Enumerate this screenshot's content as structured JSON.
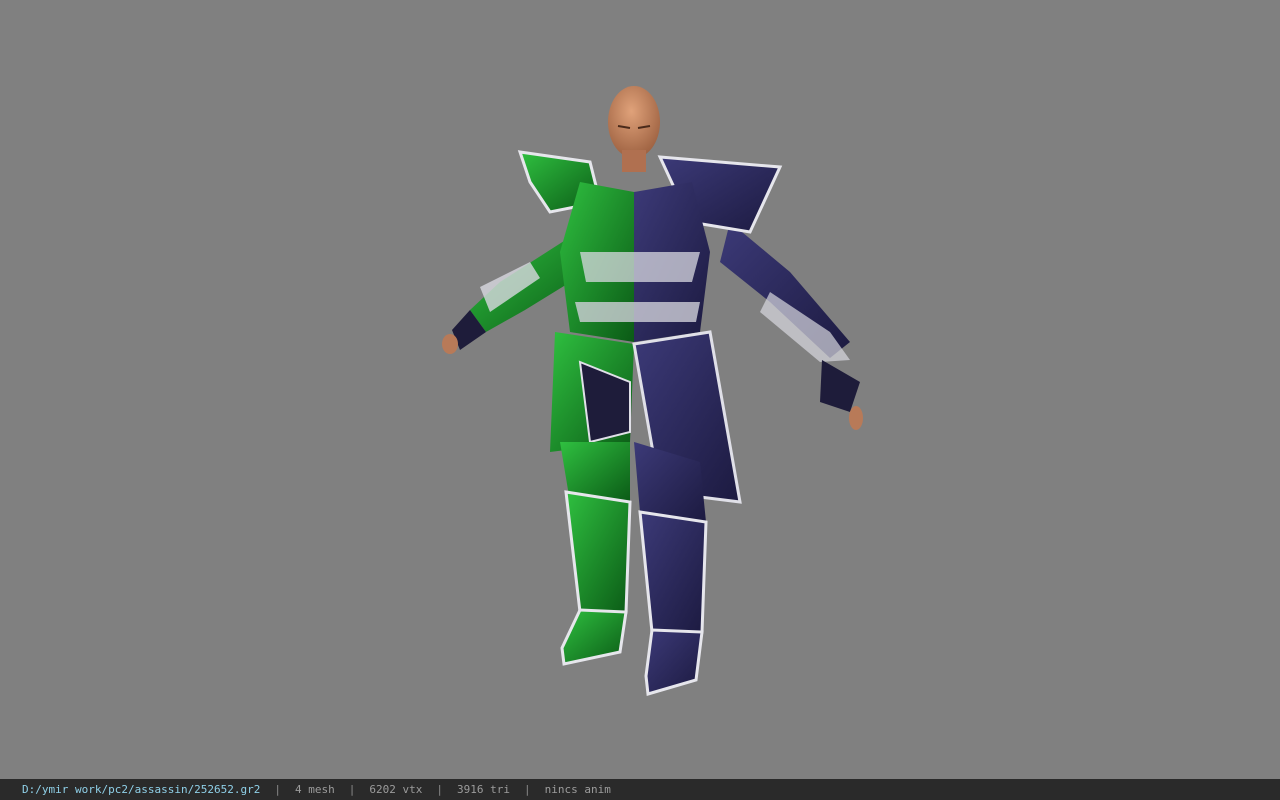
{
  "viewer": {
    "background_color": "#808080",
    "model_description": "character-model-assassin-armor",
    "colors": {
      "armor_green": "#1a8f2a",
      "armor_purple": "#2c2a5c",
      "trim_silver": "#d8d8e0",
      "skin": "#c98a65"
    }
  },
  "status_bar": {
    "file_path": "D:/ymir work/pc2/assassin/252652.gr2",
    "separator": "|",
    "mesh": "4 mesh",
    "vertices": "6202 vtx",
    "triangles": "3916 tri",
    "animation": "nincs anim"
  }
}
